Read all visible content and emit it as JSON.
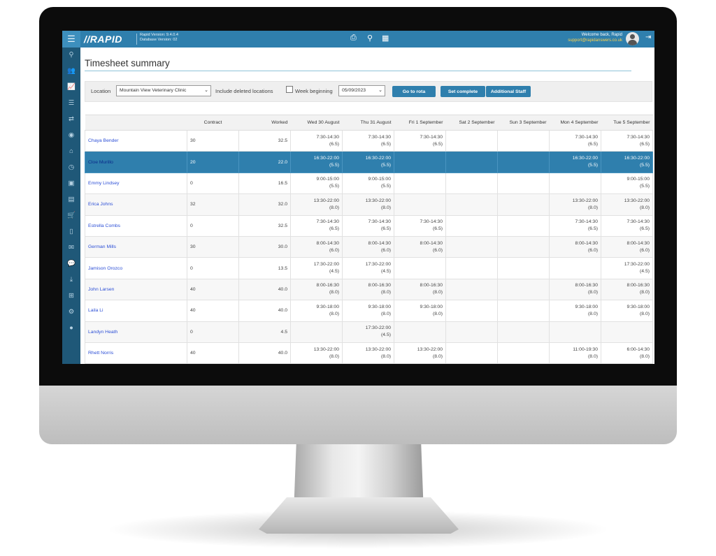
{
  "app": {
    "logo": "//RAPID",
    "version_line1": "Rapid Version: 9.4.0.4",
    "version_line2": "Database Version: 02",
    "welcome": "Welcome back, Rapid",
    "email": "support@rapidanswers.co.uk",
    "accent": "#2f7fad",
    "sidebar_color": "#1f5878"
  },
  "topbar_icons": [
    "print-icon",
    "search-icon",
    "calendar-icon"
  ],
  "sidebar_icons": [
    "search-icon",
    "users-icon",
    "chart-icon",
    "stack-icon",
    "swap-icon",
    "compass-icon",
    "home-icon",
    "clock-icon",
    "id-card-icon",
    "vcard-icon",
    "cart-icon",
    "document-icon",
    "mail-icon",
    "chat-icon",
    "download-icon",
    "org-chart-icon",
    "cogs-icon",
    "apple-icon"
  ],
  "page": {
    "title": "Timesheet summary"
  },
  "filters": {
    "location_label": "Location",
    "location_value": "Mountain View Veterinary Clinic",
    "include_deleted_label": "Include deleted locations",
    "week_label": "Week beginning",
    "week_value": "05/09/2023",
    "btn_go": "Go to rota",
    "btn_complete": "Set complete",
    "btn_additional": "Additional Staff"
  },
  "table": {
    "headers": [
      "",
      "Contract",
      "Worked",
      "Wed 30 August",
      "Thu 31 August",
      "Fri 1 September",
      "Sat 2 September",
      "Sun 3 September",
      "Mon 4 September",
      "Tue 5 September"
    ],
    "rows": [
      {
        "name": "Chaya Bender",
        "contract": "30",
        "worked": "32.5",
        "days": [
          [
            "7:30-14:30",
            "(6.5)"
          ],
          [
            "7:30-14:30",
            "(6.5)"
          ],
          [
            "7:30-14:30",
            "(6.5)"
          ],
          [
            "",
            ""
          ],
          [
            "",
            ""
          ],
          [
            "7:30-14:30",
            "(6.5)"
          ],
          [
            "7:30-14:30",
            "(6.5)"
          ]
        ]
      },
      {
        "name": "Cloe Murillo",
        "contract": "20",
        "worked": "22.0",
        "days": [
          [
            "16:30-22:00",
            "(5.5)"
          ],
          [
            "16:30-22:00",
            "(5.5)"
          ],
          [
            "",
            ""
          ],
          [
            "",
            ""
          ],
          [
            "",
            ""
          ],
          [
            "16:30-22:00",
            "(5.5)"
          ],
          [
            "16:30-22:00",
            "(5.5)"
          ]
        ]
      },
      {
        "name": "Emmy Lindsey",
        "contract": "0",
        "worked": "16.5",
        "days": [
          [
            "9:00-15:00",
            "(5.5)"
          ],
          [
            "9:00-15:00",
            "(5.5)"
          ],
          [
            "",
            ""
          ],
          [
            "",
            ""
          ],
          [
            "",
            ""
          ],
          [
            "",
            ""
          ],
          [
            "9:00-15:00",
            "(5.5)"
          ]
        ]
      },
      {
        "name": "Erica Johns",
        "contract": "32",
        "worked": "32.0",
        "days": [
          [
            "13:30-22:00",
            "(8.0)"
          ],
          [
            "13:30-22:00",
            "(8.0)"
          ],
          [
            "",
            ""
          ],
          [
            "",
            ""
          ],
          [
            "",
            ""
          ],
          [
            "13:30-22:00",
            "(8.0)"
          ],
          [
            "13:30-22:00",
            "(8.0)"
          ]
        ]
      },
      {
        "name": "Estrella Combs",
        "contract": "0",
        "worked": "32.5",
        "days": [
          [
            "7:30-14:30",
            "(6.5)"
          ],
          [
            "7:30-14:30",
            "(6.5)"
          ],
          [
            "7:30-14:30",
            "(6.5)"
          ],
          [
            "",
            ""
          ],
          [
            "",
            ""
          ],
          [
            "7:30-14:30",
            "(6.5)"
          ],
          [
            "7:30-14:30",
            "(6.5)"
          ]
        ]
      },
      {
        "name": "German Mills",
        "contract": "30",
        "worked": "30.0",
        "days": [
          [
            "8:00-14:30",
            "(6.0)"
          ],
          [
            "8:00-14:30",
            "(6.0)"
          ],
          [
            "8:00-14:30",
            "(6.0)"
          ],
          [
            "",
            ""
          ],
          [
            "",
            ""
          ],
          [
            "8:00-14:30",
            "(6.0)"
          ],
          [
            "8:00-14:30",
            "(6.0)"
          ]
        ]
      },
      {
        "name": "Jamison Orozco",
        "contract": "0",
        "worked": "13.5",
        "days": [
          [
            "17:30-22:00",
            "(4.5)"
          ],
          [
            "17:30-22:00",
            "(4.5)"
          ],
          [
            "",
            ""
          ],
          [
            "",
            ""
          ],
          [
            "",
            ""
          ],
          [
            "",
            ""
          ],
          [
            "17:30-22:00",
            "(4.5)"
          ]
        ]
      },
      {
        "name": "John Larsen",
        "contract": "40",
        "worked": "40.0",
        "days": [
          [
            "8:00-16:30",
            "(8.0)"
          ],
          [
            "8:00-16:30",
            "(8.0)"
          ],
          [
            "8:00-16:30",
            "(8.0)"
          ],
          [
            "",
            ""
          ],
          [
            "",
            ""
          ],
          [
            "8:00-16:30",
            "(8.0)"
          ],
          [
            "8:00-16:30",
            "(8.0)"
          ]
        ]
      },
      {
        "name": "Laila Li",
        "contract": "40",
        "worked": "40.0",
        "days": [
          [
            "9:30-18:00",
            "(8.0)"
          ],
          [
            "9:30-18:00",
            "(8.0)"
          ],
          [
            "9:30-18:00",
            "(8.0)"
          ],
          [
            "",
            ""
          ],
          [
            "",
            ""
          ],
          [
            "9:30-18:00",
            "(8.0)"
          ],
          [
            "9:30-18:00",
            "(8.0)"
          ]
        ]
      },
      {
        "name": "Landyn Heath",
        "contract": "0",
        "worked": "4.5",
        "days": [
          [
            "",
            ""
          ],
          [
            "17:30-22:00",
            "(4.5)"
          ],
          [
            "",
            ""
          ],
          [
            "",
            ""
          ],
          [
            "",
            ""
          ],
          [
            "",
            ""
          ],
          [
            "",
            ""
          ]
        ]
      },
      {
        "name": "Rhett Norris",
        "contract": "40",
        "worked": "40.0",
        "days": [
          [
            "13:30-22:00",
            "(8.0)"
          ],
          [
            "13:30-22:00",
            "(8.0)"
          ],
          [
            "13:30-22:00",
            "(8.0)"
          ],
          [
            "",
            ""
          ],
          [
            "",
            ""
          ],
          [
            "11:00-19:30",
            "(8.0)"
          ],
          [
            "6:00-14:30",
            "(8.0)"
          ]
        ]
      }
    ]
  }
}
